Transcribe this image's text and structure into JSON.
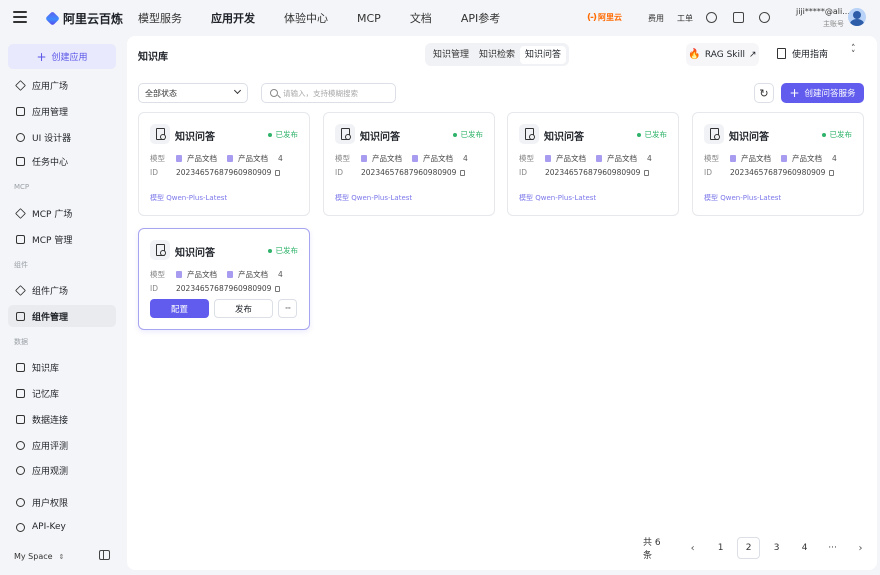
{
  "brand": {
    "name": "阿里云百炼"
  },
  "nav": {
    "tabs": [
      {
        "label": "模型服务",
        "active": false
      },
      {
        "label": "应用开发",
        "active": true
      },
      {
        "label": "体验中心",
        "active": false
      },
      {
        "label": "MCP",
        "active": false
      },
      {
        "label": "文档",
        "active": false
      },
      {
        "label": "API参考",
        "active": false
      }
    ],
    "aliyun_label": "阿里云",
    "fees": "费用",
    "tickets": "工单",
    "icons": [
      "globe-icon",
      "app-icon",
      "settings-icon"
    ],
    "user_name": "jiji*****@ali...",
    "user_role": "主账号"
  },
  "sidebar": {
    "create_label": "创建应用",
    "items_top": [
      {
        "label": "应用广场",
        "icon": "sparkle-icon"
      },
      {
        "label": "应用管理",
        "icon": "grid-icon"
      },
      {
        "label": "UI 设计器",
        "icon": "palette-icon"
      },
      {
        "label": "任务中心",
        "icon": "task-icon"
      }
    ],
    "group_mcp": "MCP",
    "items_mcp": [
      {
        "label": "MCP 广场",
        "icon": "plug-icon"
      },
      {
        "label": "MCP 管理",
        "icon": "plug-settings-icon"
      }
    ],
    "group_components": "组件",
    "items_components": [
      {
        "label": "组件广场",
        "icon": "puzzle-icon",
        "active": false
      },
      {
        "label": "组件管理",
        "icon": "puzzle-settings-icon",
        "active": true
      }
    ],
    "group_data": "数据",
    "items_data": [
      {
        "label": "知识库",
        "icon": "book-icon"
      },
      {
        "label": "记忆库",
        "icon": "memory-icon"
      },
      {
        "label": "数据连接",
        "icon": "database-icon"
      },
      {
        "label": "应用评测",
        "icon": "evaluate-icon"
      },
      {
        "label": "应用观测",
        "icon": "pie-icon"
      }
    ],
    "items_bottom": [
      {
        "label": "用户权限",
        "icon": "user-icon"
      },
      {
        "label": "API-Key",
        "icon": "key-icon"
      }
    ],
    "space_label": "My Space"
  },
  "main": {
    "title": "知识库",
    "segments": [
      {
        "label": "知识管理",
        "active": false
      },
      {
        "label": "知识检索",
        "active": false
      },
      {
        "label": "知识问答",
        "active": true
      }
    ],
    "rag_label": "RAG Skill",
    "guide_label": "使用指南",
    "filter_value": "全部状态",
    "search_placeholder": "请输入，支持模糊搜索",
    "create_service_label": "创建问答服务"
  },
  "cards": [
    {
      "title": "知识问答",
      "status": "已发布",
      "model_label": "模型",
      "tag1": "产品文档",
      "tag2": "产品文档",
      "count": "4",
      "id_label": "ID",
      "id": "20234657687960980909",
      "model_link": "模型 Qwen-Plus-Latest"
    },
    {
      "title": "知识问答",
      "status": "已发布",
      "model_label": "模型",
      "tag1": "产品文档",
      "tag2": "产品文档",
      "count": "4",
      "id_label": "ID",
      "id": "20234657687960980909",
      "model_link": "模型 Qwen-Plus-Latest"
    },
    {
      "title": "知识问答",
      "status": "已发布",
      "model_label": "模型",
      "tag1": "产品文档",
      "tag2": "产品文档",
      "count": "4",
      "id_label": "ID",
      "id": "20234657687960980909",
      "model_link": "模型 Qwen-Plus-Latest"
    },
    {
      "title": "知识问答",
      "status": "已发布",
      "model_label": "模型",
      "tag1": "产品文档",
      "tag2": "产品文档",
      "count": "4",
      "id_label": "ID",
      "id": "20234657687960980909",
      "model_link": "模型 Qwen-Plus-Latest"
    },
    {
      "title": "知识问答",
      "status": "已发布",
      "model_label": "模型",
      "tag1": "产品文档",
      "tag2": "产品文档",
      "count": "4",
      "id_label": "ID",
      "id": "20234657687960980909",
      "config_label": "配置",
      "publish_label": "发布",
      "more_label": "···"
    }
  ],
  "pagination": {
    "total": "共 6 条",
    "pages": [
      {
        "label": "1",
        "active": false
      },
      {
        "label": "2",
        "active": true
      },
      {
        "label": "3",
        "active": false
      },
      {
        "label": "4",
        "active": false
      },
      {
        "label": "···",
        "active": false
      }
    ]
  },
  "colors": {
    "primary": "#615ced",
    "success": "#2fb36a",
    "brand_orange": "#ff6a00"
  }
}
